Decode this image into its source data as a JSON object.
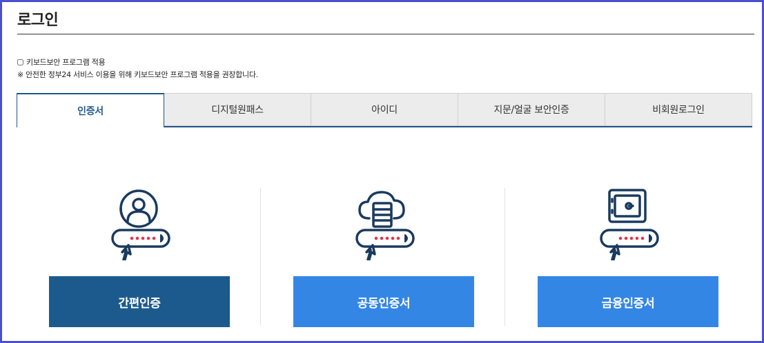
{
  "page": {
    "title": "로그인"
  },
  "keyboard_security": {
    "checkbox_label": "키보드보안 프로그램 적용",
    "checked": false,
    "notice": "※ 안전한 정부24 서비스 이용을 위해 키보드보안 프로그램 적용을 권장합니다."
  },
  "tabs": [
    {
      "label": "인증서",
      "active": true
    },
    {
      "label": "디지털원패스",
      "active": false
    },
    {
      "label": "아이디",
      "active": false
    },
    {
      "label": "지문/얼굴 보안인증",
      "active": false
    },
    {
      "label": "비회원로그인",
      "active": false
    }
  ],
  "methods": [
    {
      "icon": "person-key-icon",
      "button_label": "간편인증",
      "button_color": "#1c5a8e"
    },
    {
      "icon": "cloud-server-key-icon",
      "button_label": "공동인증서",
      "button_color": "#3486e5"
    },
    {
      "icon": "safe-key-icon",
      "button_label": "금융인증서",
      "button_color": "#3486e5"
    }
  ],
  "colors": {
    "navy": "#1a3a5e",
    "accent_red": "#e8304a",
    "frame_border": "#4a4fd1"
  }
}
